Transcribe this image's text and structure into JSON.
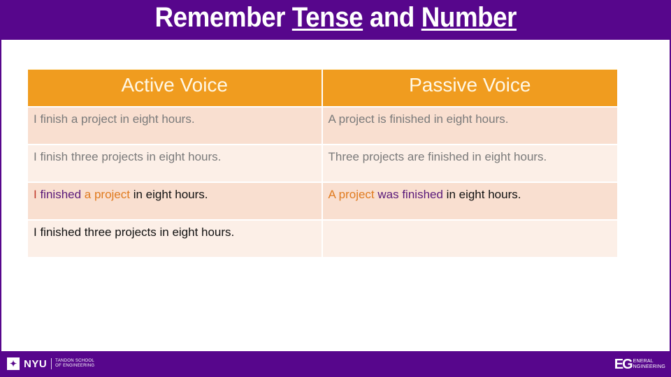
{
  "slide": {
    "title_parts": [
      "Remember ",
      "Tense",
      " and ",
      "Number"
    ]
  },
  "table": {
    "headers": [
      "Active Voice",
      "Passive Voice"
    ],
    "rows": [
      {
        "active": "I finish a project in eight hours.",
        "passive": "A project is finished in eight hours."
      },
      {
        "active": "I finish three projects in eight hours.",
        "passive": "Three projects are finished in eight hours."
      },
      {
        "active_parts": [
          "I",
          " finished",
          " a project",
          " in eight hours."
        ],
        "passive_parts": [
          "A project",
          " was finished",
          " in eight hours."
        ]
      },
      {
        "active": "I finished three projects in eight hours.",
        "passive": ""
      }
    ]
  },
  "colors": {
    "brand_purple": "#57068c",
    "header_orange": "#f09c1f",
    "row_odd": "#f9dfd0",
    "row_even": "#fcefe7",
    "subject": "#c0392b",
    "verb": "#5a1a7a",
    "object": "#e07b1f"
  },
  "footer": {
    "nyu_logo": {
      "icon": "torch-icon",
      "name": "NYU",
      "school_line1": "TANDON SCHOOL",
      "school_line2": "OF ENGINEERING"
    },
    "eg_logo": {
      "mark": "EG",
      "line1": "ENERAL",
      "line2": "NGINEERING"
    }
  }
}
